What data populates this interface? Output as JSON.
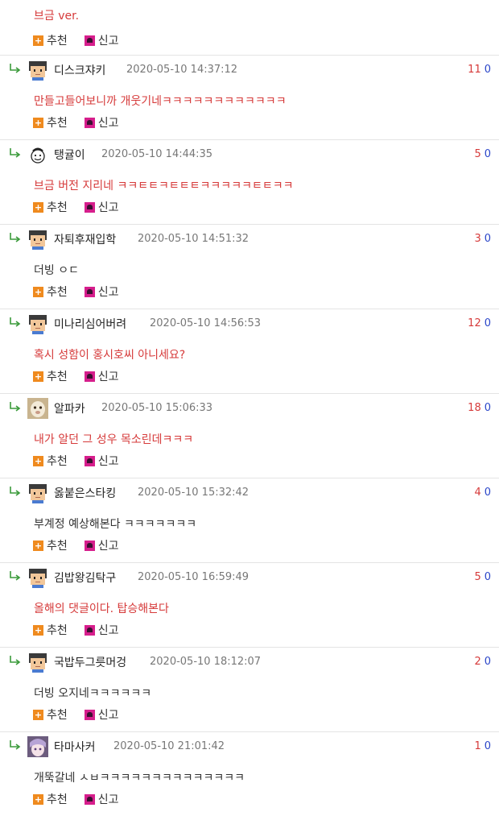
{
  "top": {
    "text": "브금 ver.",
    "recommend_label": "추천",
    "report_label": "신고"
  },
  "comments": [
    {
      "nickname": "디스크쟈키",
      "date": "2020-05-10 14:37:12",
      "up": "11",
      "down": "0",
      "text": "만들고들어보니까 개웃기네ㅋㅋㅋㅋㅋㅋㅋㅋㅋㅋㅋㅋ",
      "text_color": "red",
      "avatar": "pixel-face"
    },
    {
      "nickname": "탱귤이",
      "date": "2020-05-10 14:44:35",
      "up": "5",
      "down": "0",
      "text": "브금 버전 지리네 ㅋㅋㅌㅌㅋㅌㅌㅌㅋㅋㅋㅋㅋㅌㅌㅋㅋ",
      "text_color": "red",
      "avatar": "doodle-face"
    },
    {
      "nickname": "자퇴후재입학",
      "date": "2020-05-10 14:51:32",
      "up": "3",
      "down": "0",
      "text": "더빙 ㅇㄷ",
      "text_color": "dark",
      "avatar": "pixel-face"
    },
    {
      "nickname": "미나리심어버려",
      "date": "2020-05-10 14:56:53",
      "up": "12",
      "down": "0",
      "text": "혹시 성함이 홍시호씨 아니세요?",
      "text_color": "red",
      "avatar": "pixel-face"
    },
    {
      "nickname": "알파카",
      "date": "2020-05-10 15:06:33",
      "up": "18",
      "down": "0",
      "text": "내가 알던 그 성우 목소린데ㅋㅋㅋ",
      "text_color": "red",
      "avatar": "photo-alpaca"
    },
    {
      "nickname": "옳붙은스타킹",
      "date": "2020-05-10 15:32:42",
      "up": "4",
      "down": "0",
      "text": "부계정 예상해본다 ㅋㅋㅋㅋㅋㅋㅋ",
      "text_color": "dark",
      "avatar": "pixel-face"
    },
    {
      "nickname": "김밥왕김탁구",
      "date": "2020-05-10 16:59:49",
      "up": "5",
      "down": "0",
      "text": "올해의 댓글이다. 탑승해본다",
      "text_color": "red",
      "avatar": "pixel-face"
    },
    {
      "nickname": "국밥두그릇머겅",
      "date": "2020-05-10 18:12:07",
      "up": "2",
      "down": "0",
      "text": "더빙 오지네ㅋㅋㅋㅋㅋㅋ",
      "text_color": "dark",
      "avatar": "pixel-face"
    },
    {
      "nickname": "타마사커",
      "date": "2020-05-10 21:01:42",
      "up": "1",
      "down": "0",
      "text": "개뚝갈네 ㅅㅂㅋㅋㅋㅋㅋㅋㅋㅋㅋㅋㅋㅋㅋㅋ",
      "text_color": "dark",
      "avatar": "photo-anime"
    }
  ],
  "colors": {
    "red_text": "#d63a3a",
    "upvote": "#d63a3a",
    "downvote": "#2b46c9",
    "recommend_icon": "#ef8a1e",
    "report_icon": "#d61e8c"
  }
}
